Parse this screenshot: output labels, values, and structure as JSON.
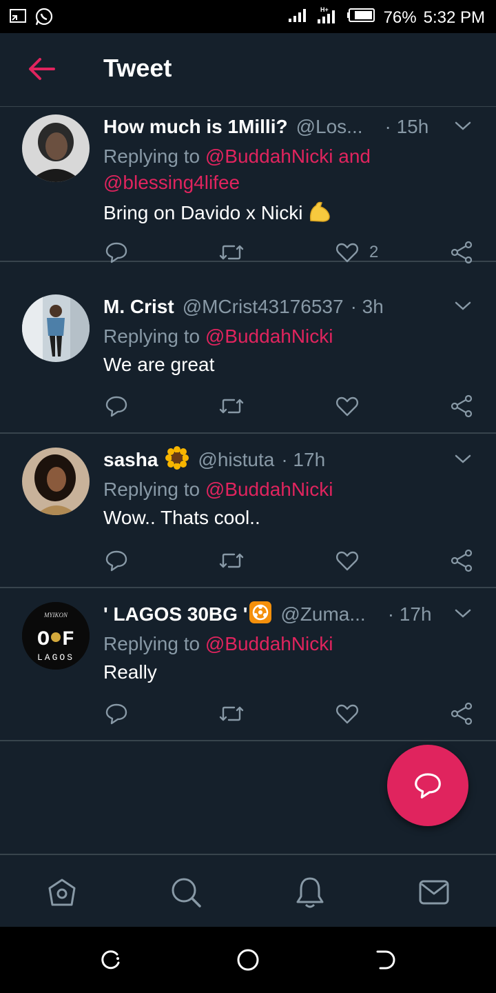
{
  "status_bar": {
    "battery": "76%",
    "time": "5:32 PM",
    "network_label": "H+"
  },
  "header": {
    "title": "Tweet"
  },
  "tweets": [
    {
      "name": "How much is 1Milli?",
      "handle": "@Los...",
      "time": "· 15h",
      "replying_prefix": "Replying to ",
      "mention1": "@BuddahNicki",
      "mention_sep": " and",
      "mention2": "@blessing4lifee",
      "text": "Bring on Davido x Nicki",
      "emoji": "flexed-biceps-emoji",
      "like_count": "2"
    },
    {
      "name": "M. Crist",
      "handle": "@MCrist43176537",
      "time": "· 3h",
      "replying_prefix": "Replying to ",
      "mention1": "@BuddahNicki",
      "text": "We are great",
      "like_count": ""
    },
    {
      "name": "sasha",
      "name_emoji": "sunflower-emoji",
      "handle": "@histuta",
      "time": "· 17h",
      "replying_prefix": "Replying to ",
      "mention1": "@BuddahNicki",
      "text": "Wow.. Thats cool..",
      "like_count": ""
    },
    {
      "name": "' LAGOS 30BG '",
      "name_emoji": "biohazard-emoji",
      "handle": "@Zuma...",
      "time": "· 17h",
      "replying_prefix": "Replying to ",
      "mention1": "@BuddahNicki",
      "text": "Really",
      "like_count": "",
      "avatar_text_top": "MYIKON",
      "avatar_text_mid": "O F",
      "avatar_text_bottom": "LAGOS"
    }
  ],
  "colors": {
    "background": "#15202b",
    "accent": "#e0245e",
    "muted": "#8899a6",
    "divider": "#38444d"
  },
  "icons": {
    "back": "back-arrow-icon",
    "caret": "chevron-down-icon",
    "reply": "reply-icon",
    "retweet": "retweet-icon",
    "like": "heart-icon",
    "share": "share-icon",
    "fab": "compose-reply-icon",
    "nav": [
      "home-icon",
      "search-icon",
      "notifications-icon",
      "messages-icon"
    ],
    "system": [
      "recent-apps-icon",
      "home-circle-icon",
      "back-icon"
    ]
  }
}
